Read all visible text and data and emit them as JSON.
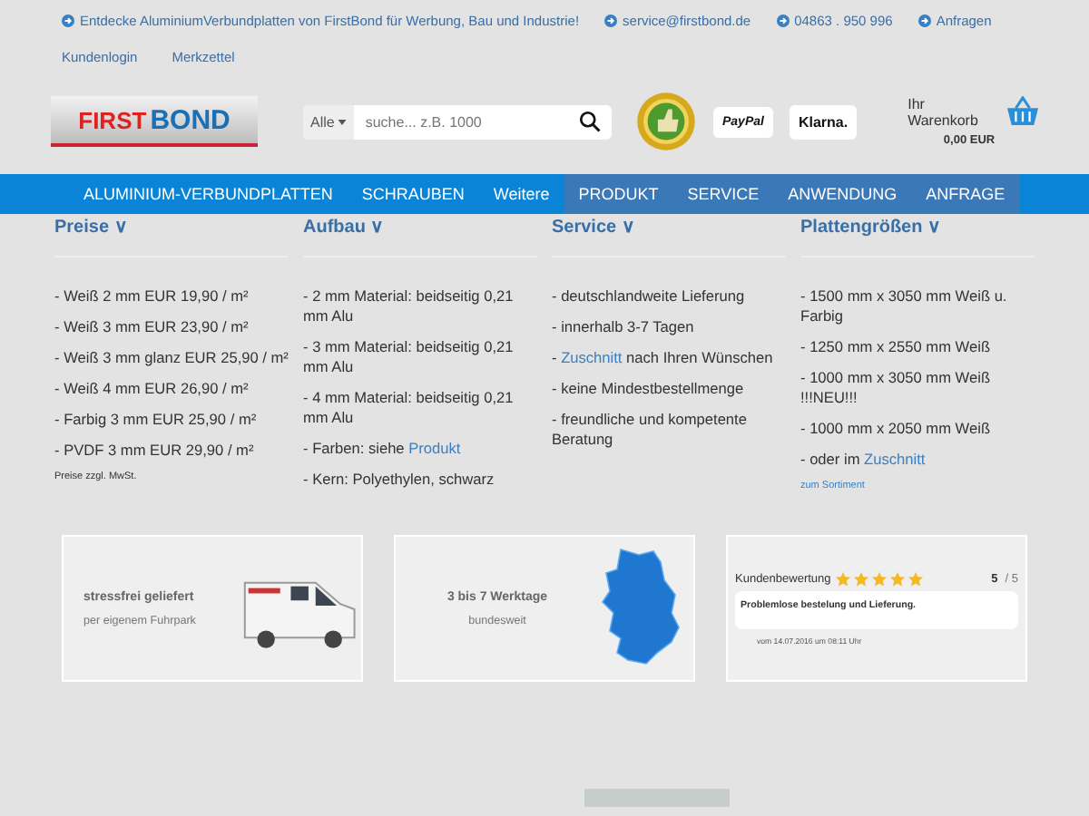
{
  "topbar": {
    "links": [
      {
        "text": "Entdecke AluminiumVerbundplatten von FirstBond für Werbung, Bau und Industrie!"
      },
      {
        "text": "service@firstbond.de"
      },
      {
        "text": "04863 . 950 996"
      },
      {
        "text": "Anfragen"
      }
    ],
    "account": [
      "Kundenlogin",
      "Merkzettel"
    ]
  },
  "header": {
    "logo": {
      "word1": "FIRST",
      "word2": "BOND"
    },
    "search": {
      "category": "Alle",
      "placeholder": "suche... z.B. 1000"
    },
    "payment": [
      "PayPal",
      "Klarna."
    ],
    "cart": {
      "label": "Ihr Warenkorb",
      "total": "0,00 EUR"
    }
  },
  "nav": [
    {
      "label": "ALUMINIUM-VERBUNDPLATTEN",
      "kind": "main"
    },
    {
      "label": "SCHRAUBEN",
      "kind": "main"
    },
    {
      "label": "Weitere",
      "kind": "main"
    },
    {
      "label": "PRODUKT",
      "kind": "info"
    },
    {
      "label": "SERVICE",
      "kind": "info"
    },
    {
      "label": "ANWENDUNG",
      "kind": "info"
    },
    {
      "label": "ANFRAGE",
      "kind": "info"
    }
  ],
  "columns": [
    {
      "heading": "Preise ∨",
      "items": [
        {
          "text": "- Weiß 2 mm EUR 19,90 / m²"
        },
        {
          "text": "- Weiß 3 mm EUR 23,90 / m²"
        },
        {
          "text": "- Weiß 3 mm glanz EUR 25,90 / m²"
        },
        {
          "text": "- Weiß 4 mm EUR 26,90 / m²"
        },
        {
          "text": "- Farbig 3 mm EUR 25,90 / m²"
        },
        {
          "text": "- PVDF 3 mm EUR 29,90 / m²"
        }
      ],
      "note": "Preise zzgl. MwSt."
    },
    {
      "heading": "Aufbau ∨",
      "items": [
        {
          "text": "- 2 mm Material: beidseitig 0,21 mm Alu"
        },
        {
          "text": "- 3 mm Material: beidseitig 0,21 mm Alu"
        },
        {
          "text": "- 4 mm Material: beidseitig 0,21 mm Alu"
        },
        {
          "text": "- Farben: siehe ",
          "link": "Produkt"
        },
        {
          "text": "- Kern: Polyethylen, schwarz"
        }
      ]
    },
    {
      "heading": "Service ∨",
      "items": [
        {
          "text": "- deutschlandweite Lieferung"
        },
        {
          "text": "- innerhalb 3-7 Tagen"
        },
        {
          "text": "- ",
          "link": "Zuschnitt",
          "after": " nach Ihren Wünschen"
        },
        {
          "text": "- keine Mindestbestellmenge"
        },
        {
          "text": "- freundliche und kompetente Beratung"
        }
      ]
    },
    {
      "heading": "Plattengrößen ∨",
      "items": [
        {
          "text": "- 1500 mm x 3050 mm  Weiß u. Farbig"
        },
        {
          "text": "- 1250 mm x 2550 mm  Weiß"
        },
        {
          "text": "- 1000 mm x 3050 mm  Weiß !!!NEU!!!"
        },
        {
          "text": "- 1000 mm x 2050 mm  Weiß"
        },
        {
          "text": "- oder im ",
          "link": "Zuschnitt"
        }
      ],
      "more_link": "zum Sortiment"
    }
  ],
  "banners": [
    {
      "kind": "delivery",
      "title": "stressfrei geliefert",
      "subtitle": "per eigenem Fuhrpark"
    },
    {
      "kind": "map",
      "title": "3 bis 7 Werktage",
      "subtitle": "bundesweit"
    },
    {
      "kind": "review",
      "title": "Kundenbewertung",
      "stars": 5,
      "score": "5",
      "max": "/ 5",
      "comment": "Problemlose bestelung und Lieferung.",
      "date": "vom 14.07.2016 um 08:11 Uhr"
    }
  ]
}
